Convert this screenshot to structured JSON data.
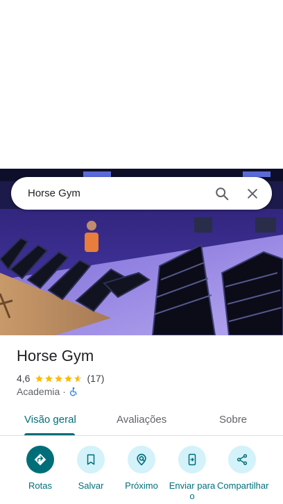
{
  "search": {
    "query": "Horse Gym"
  },
  "place": {
    "name": "Horse Gym",
    "rating": "4,6",
    "stars": 4.6,
    "review_count": "(17)",
    "category": "Academia",
    "separator": "·"
  },
  "tabs": [
    {
      "label": "Visão geral",
      "active": true
    },
    {
      "label": "Avaliações",
      "active": false
    },
    {
      "label": "Sobre",
      "active": false
    }
  ],
  "actions": [
    {
      "label": "Rotas",
      "icon": "directions-icon"
    },
    {
      "label": "Salvar",
      "icon": "bookmark-icon"
    },
    {
      "label": "Próximo",
      "icon": "nearby-icon"
    },
    {
      "label": "Enviar para o",
      "icon": "send-to-phone-icon"
    },
    {
      "label": "Compartilhar",
      "icon": "share-icon"
    }
  ],
  "colors": {
    "accent": "#006e78",
    "action_bg": "#d3f2fa",
    "star": "#fbbc04"
  }
}
